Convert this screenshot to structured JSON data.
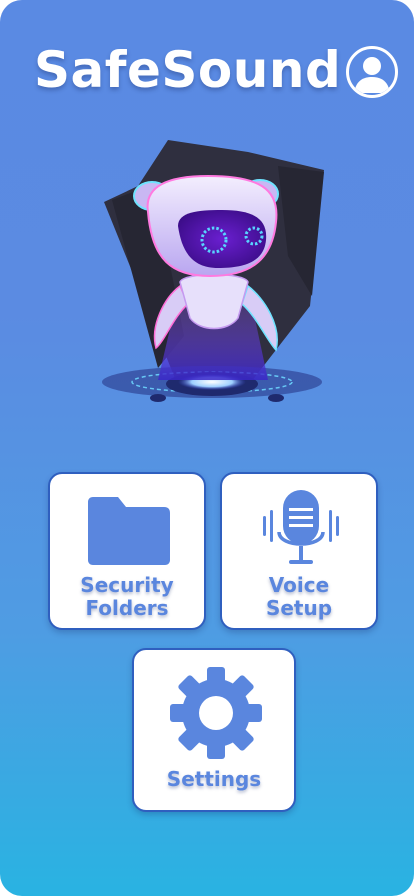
{
  "app": {
    "title": "SafeSound"
  },
  "header": {
    "profile_icon": "user-circle-icon"
  },
  "hero": {
    "image": "robot-hologram-illustration"
  },
  "menu": {
    "security_folders": {
      "line1": "Security",
      "line2": "Folders",
      "icon": "folder-icon"
    },
    "voice_setup": {
      "line1": "Voice",
      "line2": "Setup",
      "icon": "microphone-icon"
    },
    "settings": {
      "label": "Settings",
      "icon": "gear-icon"
    }
  },
  "colors": {
    "background_top": "#5a8ae3",
    "background_bottom": "#29b3e2",
    "accent": "#5a86de",
    "card_border": "#2f5fbf"
  }
}
